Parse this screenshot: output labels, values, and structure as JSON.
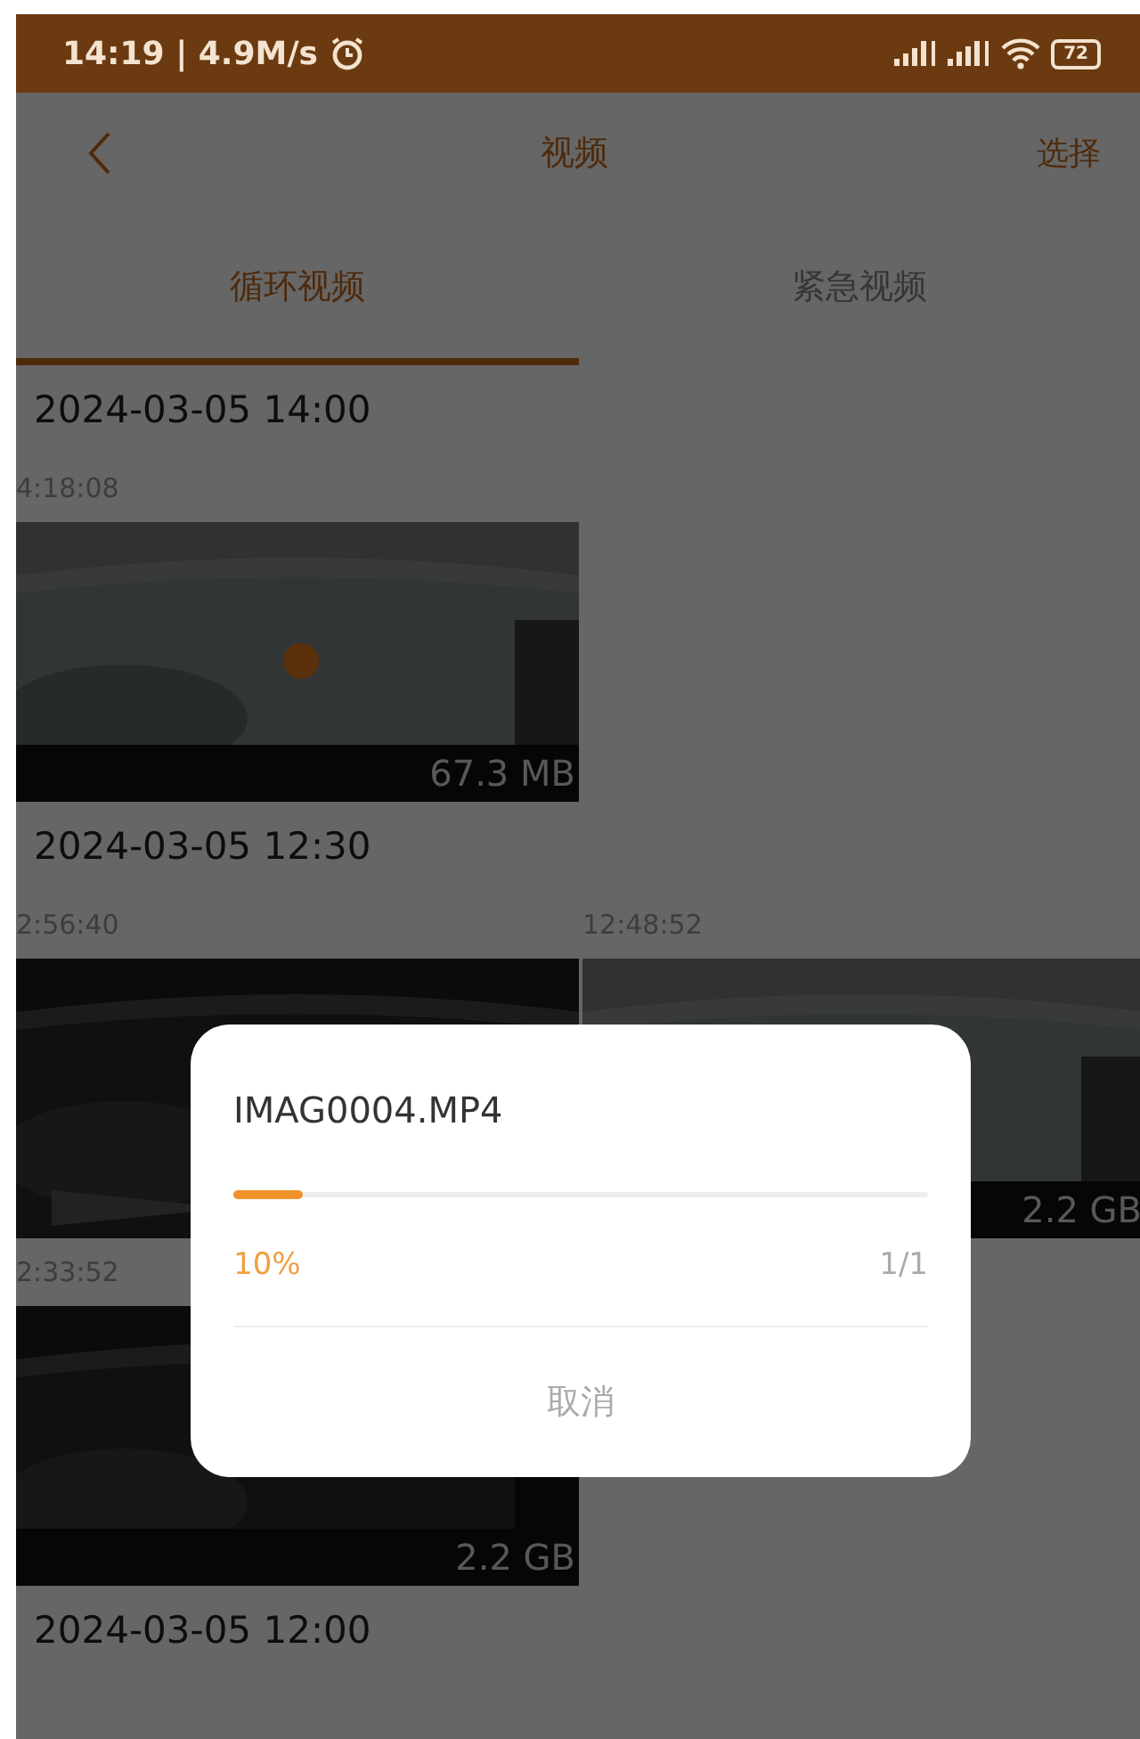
{
  "status_bar": {
    "time_speed": "14:19 | 4.9M/s",
    "battery": "72"
  },
  "header": {
    "title": "视频",
    "action": "选择"
  },
  "tabs": [
    {
      "label": "循环视频",
      "selected": true
    },
    {
      "label": "紧急视频",
      "selected": false
    }
  ],
  "groups": [
    {
      "date": "2024-03-05 14:00",
      "videos": [
        {
          "time": "4:18:08",
          "size": "67.3 MB"
        }
      ]
    },
    {
      "date": "2024-03-05 12:30",
      "videos": [
        {
          "time": "2:56:40"
        },
        {
          "time": "12:48:52",
          "size": "2.2 GB"
        },
        {
          "time": "2:33:52",
          "size": "2.2 GB"
        }
      ]
    },
    {
      "date": "2024-03-05 12:00"
    }
  ],
  "dialog": {
    "file": "IMAG0004.MP4",
    "level": 0.1,
    "percent": "10%",
    "count": "1/1",
    "cancel": "取消"
  }
}
